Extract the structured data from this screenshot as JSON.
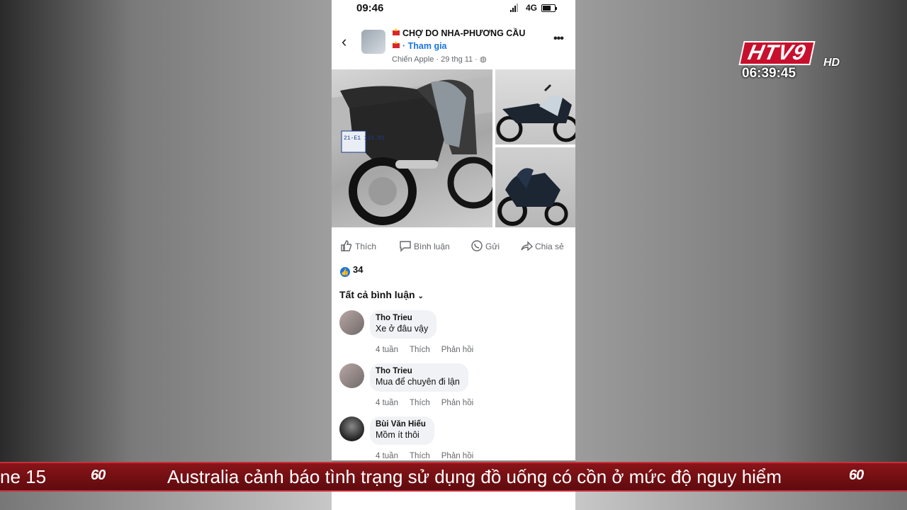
{
  "phone": {
    "status": {
      "time": "09:46",
      "network": "4G"
    },
    "header": {
      "group_name": "CHỢ DO NHA-PHƯƠNG CẦU",
      "join_label": "· Tham gia",
      "meta": "Chiến Apple · 29 thg 11 · "
    },
    "actions": {
      "like": "Thích",
      "comment": "Bình luận",
      "send": "Gửi",
      "share": "Chia sẻ"
    },
    "like_count": "34",
    "all_comments_label": "Tất cả bình luận",
    "comments": [
      {
        "name": "Tho Trieu",
        "text": "Xe ở đâu vậy",
        "age": "4 tuần",
        "like": "Thích",
        "reply": "Phản hồi"
      },
      {
        "name": "Tho Trieu",
        "text": "Mua để chuyên đi lận",
        "age": "4 tuần",
        "like": "Thích",
        "reply": "Phản hồi"
      },
      {
        "name": "Bùi Văn Hiếu",
        "text": "Mồm ít thôi",
        "age": "4 tuần",
        "like": "Thích",
        "reply": "Phản hồi"
      }
    ],
    "plate_text": "21-E1 121.03"
  },
  "broadcast": {
    "channel_logo": "HTV9",
    "channel_suffix": "HD",
    "clock": "06:39:45",
    "ticker_left": "ne 15",
    "ticker_text": "Australia cảnh báo tình trạng sử dụng đồ uống có cồn ở mức độ nguy hiểm",
    "ticker_logo": "60"
  },
  "colors": {
    "accent": "#1b74e4",
    "ticker_bg": "#7a1116",
    "logo_red": "#c8102e"
  }
}
